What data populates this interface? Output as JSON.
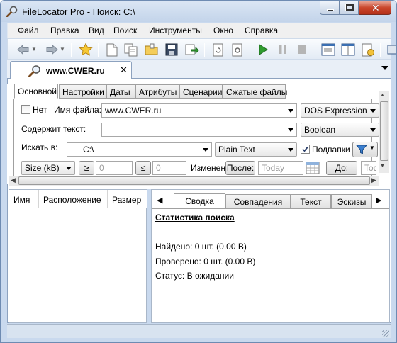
{
  "window": {
    "title": "FileLocator Pro - Поиск: C:\\"
  },
  "menu": [
    "Файл",
    "Правка",
    "Вид",
    "Поиск",
    "Инструменты",
    "Окно",
    "Справка"
  ],
  "toolbar_icons": [
    "back-icon",
    "forward-icon",
    "favorites-star-icon",
    "new-search-icon",
    "copy-icon",
    "open-folder-icon",
    "save-icon",
    "export-icon",
    "refresh-icon",
    "options-icon",
    "start-search-icon",
    "pause-icon",
    "stop-icon",
    "layout-icon",
    "window-icon",
    "report-icon"
  ],
  "doc_tab": {
    "label": "www.CWER.ru"
  },
  "criteria_tabs": [
    "Основной",
    "Настройки",
    "Даты",
    "Атрибуты",
    "Сценарии",
    "Сжатые файлы"
  ],
  "criteria": {
    "not_label": "Нет",
    "filename_label": "Имя файла:",
    "filename_value": "www.CWER.ru",
    "filename_mode": "DOS Expression",
    "contains_label": "Содержит текст:",
    "contains_value": "",
    "contains_mode": "Boolean",
    "lookin_label": "Искать в:",
    "lookin_value": "C:\\",
    "lookin_mode": "Plain Text",
    "subfolders_label": "Подпапки",
    "size_unit": "Size (kB)",
    "gte_label": "≥",
    "gte_value": "0",
    "lte_label": "≤",
    "lte_value": "0",
    "modified_label": "Изменен:",
    "after_button": "После:",
    "after_placeholder": "Today",
    "before_button": "До:",
    "before_placeholder": "Tod"
  },
  "results_columns": [
    "Имя",
    "Расположение",
    "Размер"
  ],
  "result_tabs": [
    "Сводка",
    "Совпадения",
    "Текст",
    "Эскизы"
  ],
  "summary": {
    "heading": "Статистика поиска",
    "found": "Найдено: 0 шт. (0.00 B)",
    "checked": "Проверено: 0 шт. (0.00 B)",
    "status": "Статус: В ожидании"
  },
  "colors": {
    "chrome": "#c9d9ee",
    "accent_green": "#2f9c2f"
  }
}
